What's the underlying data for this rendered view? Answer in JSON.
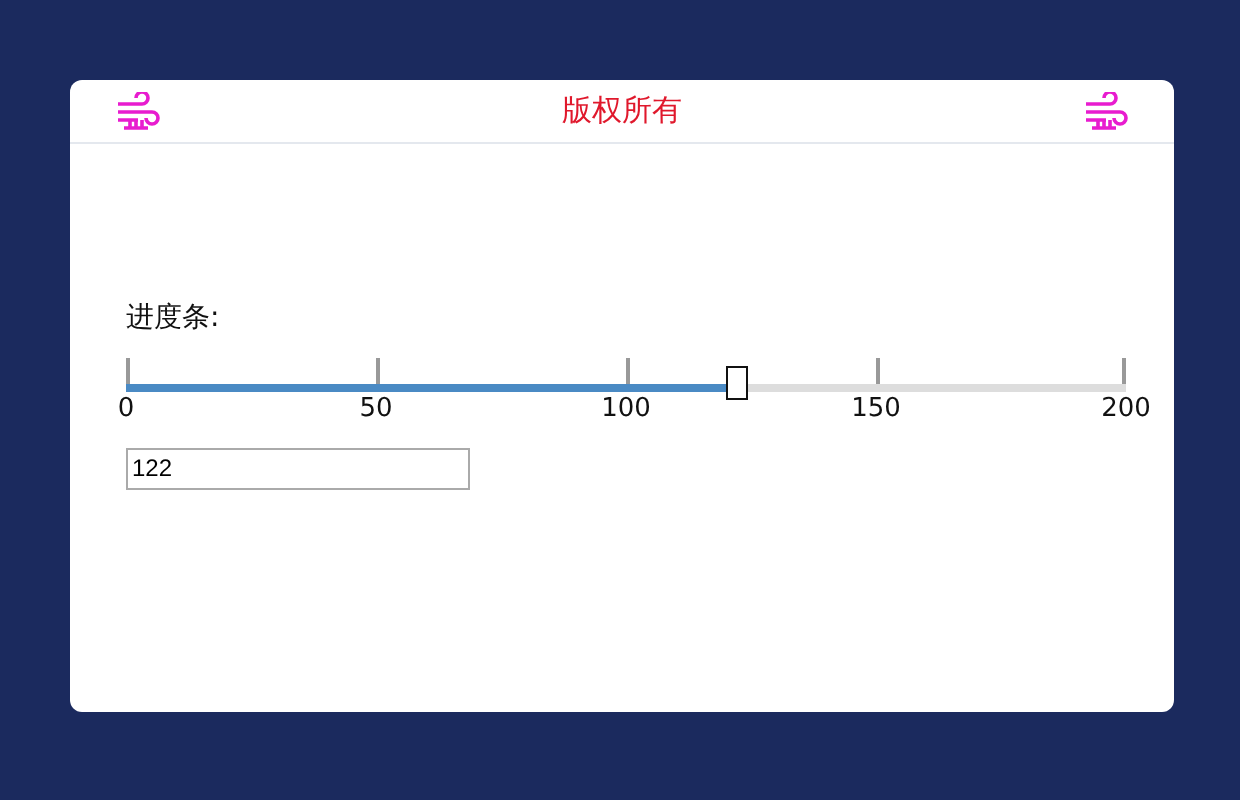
{
  "header": {
    "title": "版权所有"
  },
  "slider": {
    "label": "进度条:",
    "level": 0.61,
    "ticks": [
      "0",
      "50",
      "100",
      "150",
      "200"
    ],
    "value": "122"
  }
}
